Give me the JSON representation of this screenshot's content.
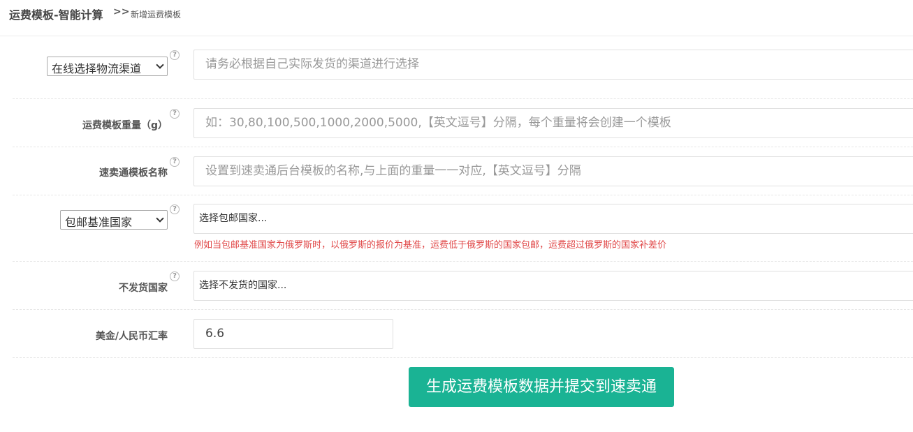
{
  "header": {
    "title": "运费模板-智能计算",
    "separator": ">>",
    "subtitle": "新增运费模板"
  },
  "form": {
    "channel": {
      "select_value": "在线选择物流渠道",
      "help": "?",
      "placeholder": "请务必根据自己实际发货的渠道进行选择"
    },
    "weight": {
      "label": "运费模板重量（g）",
      "help": "?",
      "placeholder": "如：30,80,100,500,1000,2000,5000,【英文逗号】分隔，每个重量将会创建一个模板"
    },
    "template_name": {
      "label": "速卖通模板名称",
      "help": "?",
      "placeholder": "设置到速卖通后台模板的名称,与上面的重量一一对应,【英文逗号】分隔"
    },
    "base_country": {
      "select_value": "包邮基准国家",
      "help": "?",
      "chooser_text": "选择包邮国家...",
      "hint": "例如当包邮基准国家为俄罗斯时，以俄罗斯的报价为基准，运费低于俄罗斯的国家包邮，运费超过俄罗斯的国家补差价"
    },
    "no_ship": {
      "label": "不发货国家",
      "help": "?",
      "chooser_text": "选择不发货的国家..."
    },
    "exchange_rate": {
      "label": "美金/人民币汇率",
      "value": "6.6"
    }
  },
  "submit_label": "生成运费模板数据并提交到速卖通"
}
